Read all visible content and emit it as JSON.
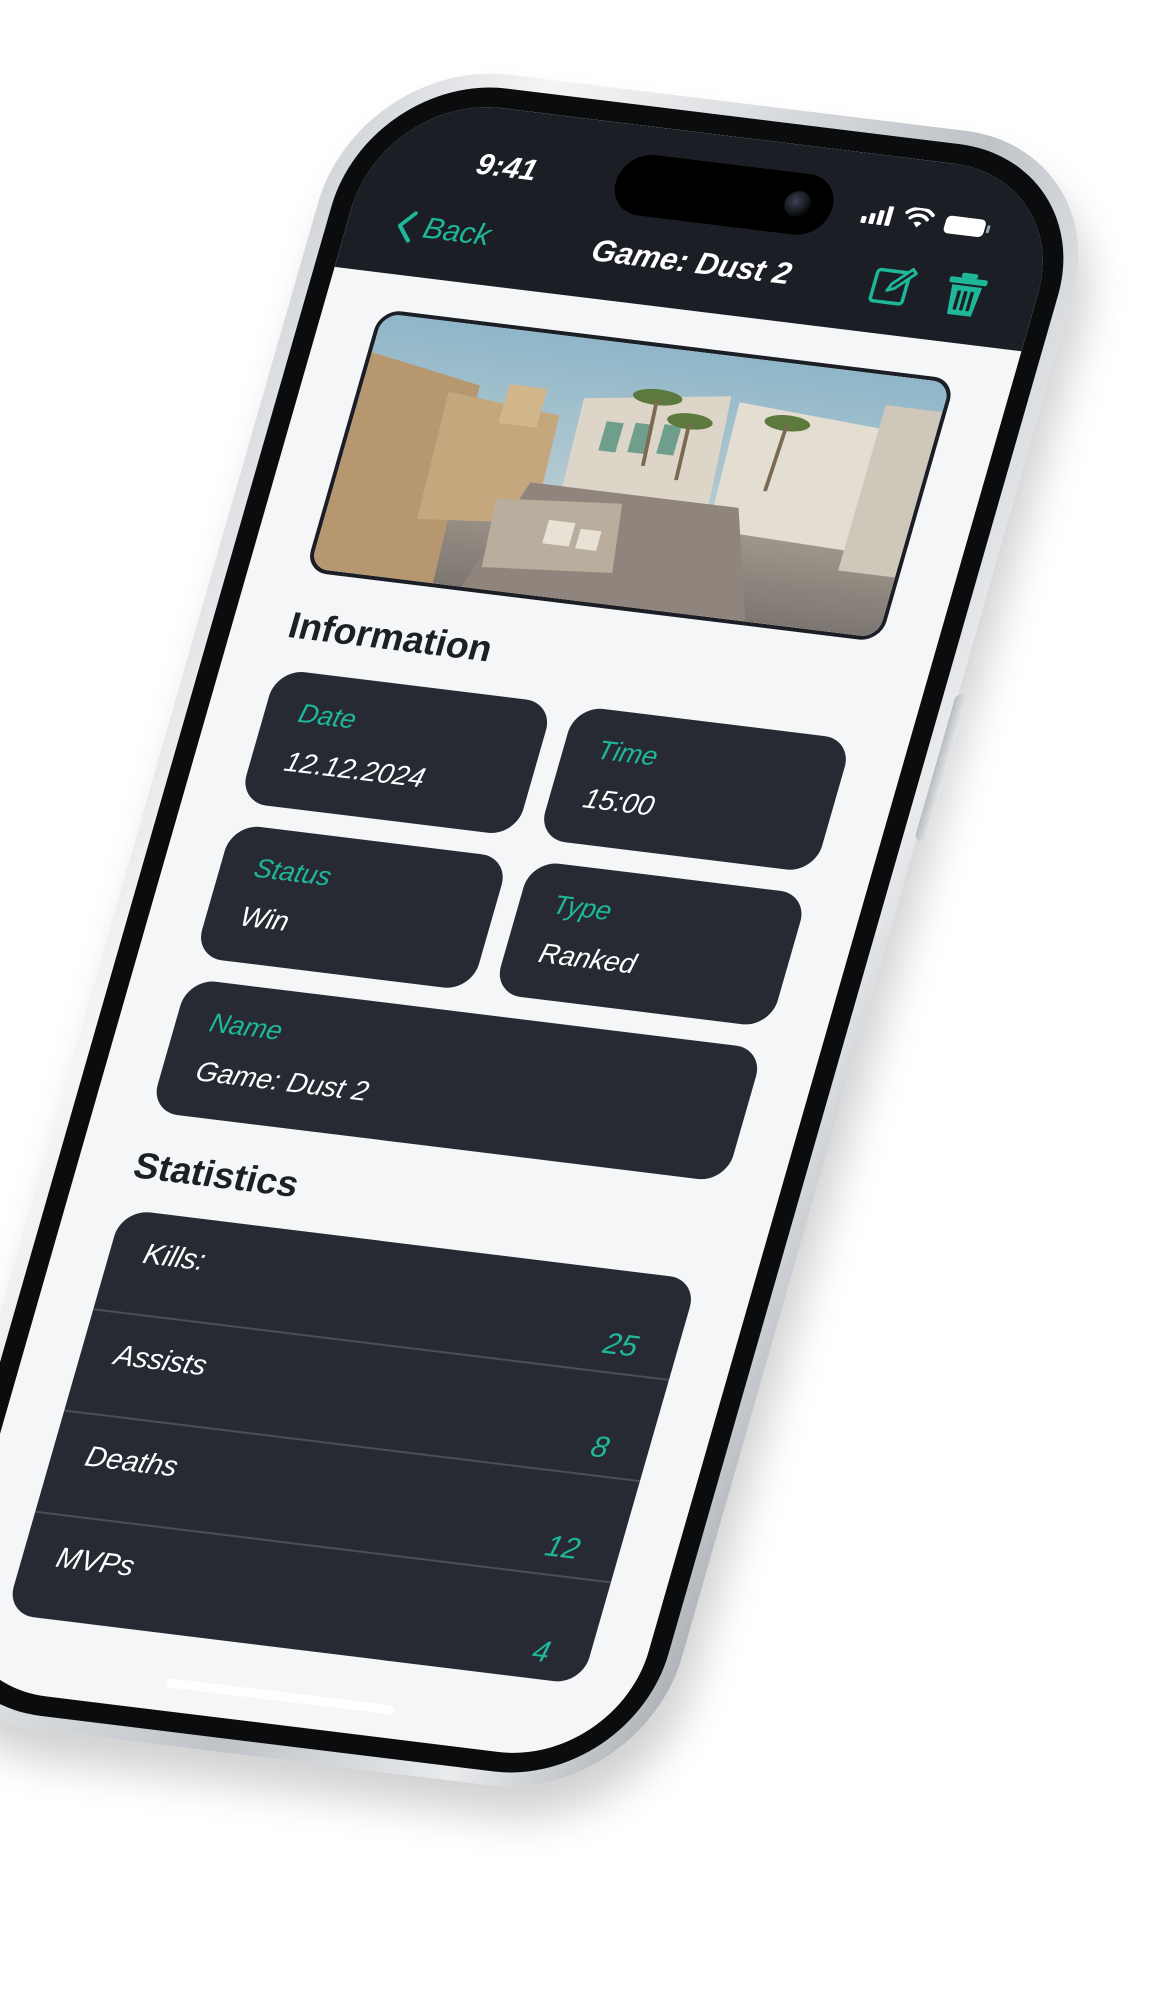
{
  "status_bar": {
    "time": "9:41"
  },
  "nav": {
    "back_label": "Back",
    "title": "Game: Dust 2",
    "edit_icon": "edit-square-icon",
    "delete_icon": "trash-icon"
  },
  "map_image": {
    "description_icon": "map-screenshot-image"
  },
  "information": {
    "section_title": "Information",
    "date_label": "Date",
    "date_value": "12.12.2024",
    "time_label": "Time",
    "time_value": "15:00",
    "status_label": "Status",
    "status_value": "Win",
    "type_label": "Type",
    "type_value": "Ranked",
    "name_label": "Name",
    "name_value": "Game: Dust 2"
  },
  "statistics": {
    "section_title": "Statistics",
    "rows": [
      {
        "label": "Kills:",
        "value": "25"
      },
      {
        "label": "Assists",
        "value": "8"
      },
      {
        "label": "Deaths",
        "value": "12"
      },
      {
        "label": "MVPs",
        "value": "4"
      }
    ]
  },
  "colors": {
    "accent": "#1fb79a",
    "card": "#272a33",
    "header": "#1b1e24",
    "background": "#f4f6f8"
  }
}
